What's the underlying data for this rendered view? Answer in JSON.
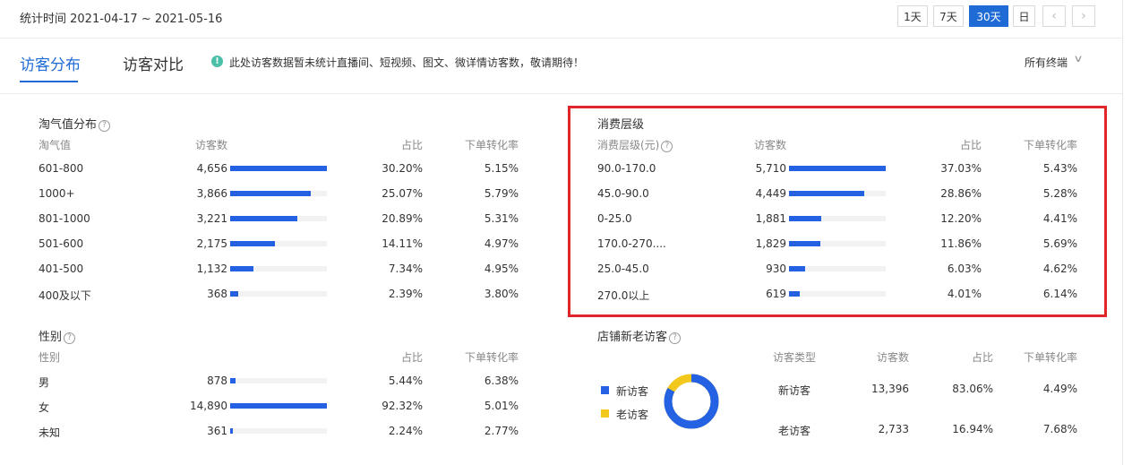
{
  "header": {
    "date_range": "统计时间 2021-04-17 ~ 2021-05-16",
    "range_buttons": [
      "1天",
      "7天",
      "30天",
      "日"
    ],
    "active_range": "30天",
    "prev_arrow": "‹",
    "next_arrow": "›"
  },
  "tabs": {
    "items": [
      "访客分布",
      "访客对比"
    ],
    "active": "访客分布",
    "notice": "此处访客数据暂未统计直播间、短视频、图文、微详情访客数，敬请期待！",
    "terminal_filter": "所有终端"
  },
  "taoqi": {
    "title": "淘气值分布",
    "headers": [
      "淘气值",
      "访客数",
      "占比",
      "下单转化率"
    ],
    "rows": [
      {
        "label": "601-800",
        "visitors": "4,656",
        "share": "30.20%",
        "share_pct": 30.2,
        "conv": "5.15%"
      },
      {
        "label": "1000+",
        "visitors": "3,866",
        "share": "25.07%",
        "share_pct": 25.07,
        "conv": "5.79%"
      },
      {
        "label": "801-1000",
        "visitors": "3,221",
        "share": "20.89%",
        "share_pct": 20.89,
        "conv": "5.31%"
      },
      {
        "label": "501-600",
        "visitors": "2,175",
        "share": "14.11%",
        "share_pct": 14.11,
        "conv": "4.97%"
      },
      {
        "label": "401-500",
        "visitors": "1,132",
        "share": "7.34%",
        "share_pct": 7.34,
        "conv": "4.95%"
      },
      {
        "label": "400及以下",
        "visitors": "368",
        "share": "2.39%",
        "share_pct": 2.39,
        "conv": "3.80%"
      }
    ]
  },
  "consume": {
    "title": "消费层级",
    "headers": [
      "消费层级(元)",
      "访客数",
      "占比",
      "下单转化率"
    ],
    "rows": [
      {
        "label": "90.0-170.0",
        "visitors": "5,710",
        "share": "37.03%",
        "share_pct": 37.03,
        "conv": "5.43%"
      },
      {
        "label": "45.0-90.0",
        "visitors": "4,449",
        "share": "28.86%",
        "share_pct": 28.86,
        "conv": "5.28%"
      },
      {
        "label": "0-25.0",
        "visitors": "1,881",
        "share": "12.20%",
        "share_pct": 12.2,
        "conv": "4.41%"
      },
      {
        "label": "170.0-270....",
        "visitors": "1,829",
        "share": "11.86%",
        "share_pct": 11.86,
        "conv": "5.69%"
      },
      {
        "label": "25.0-45.0",
        "visitors": "930",
        "share": "6.03%",
        "share_pct": 6.03,
        "conv": "4.62%"
      },
      {
        "label": "270.0以上",
        "visitors": "619",
        "share": "4.01%",
        "share_pct": 4.01,
        "conv": "6.14%"
      }
    ]
  },
  "gender": {
    "title": "性别",
    "headers": [
      "性别",
      "占比",
      "下单转化率"
    ],
    "rows": [
      {
        "label": "男",
        "visitors": "878",
        "share": "5.44%",
        "share_pct": 5.44,
        "conv": "6.38%"
      },
      {
        "label": "女",
        "visitors": "14,890",
        "share": "92.32%",
        "share_pct": 92.32,
        "conv": "5.01%"
      },
      {
        "label": "未知",
        "visitors": "361",
        "share": "2.24%",
        "share_pct": 2.24,
        "conv": "2.77%"
      }
    ]
  },
  "shop_visitors": {
    "title": "店铺新老访客",
    "legend": [
      {
        "label": "新访客",
        "color": "#2562e3"
      },
      {
        "label": "老访客",
        "color": "#f2c81d"
      }
    ],
    "donut_new_share": 0.8306,
    "headers": [
      "访客类型",
      "访客数",
      "占比",
      "下单转化率"
    ],
    "rows": [
      {
        "type": "新访客",
        "visitors": "13,396",
        "share": "83.06%",
        "conv": "4.49%"
      },
      {
        "type": "老访客",
        "visitors": "2,733",
        "share": "16.94%",
        "conv": "7.68%"
      }
    ]
  },
  "colors": {
    "accent": "#1f6bd6",
    "bar": "#2562e3",
    "highlight_box": "#e0252b",
    "notice_icon": "#4bbfa7"
  }
}
